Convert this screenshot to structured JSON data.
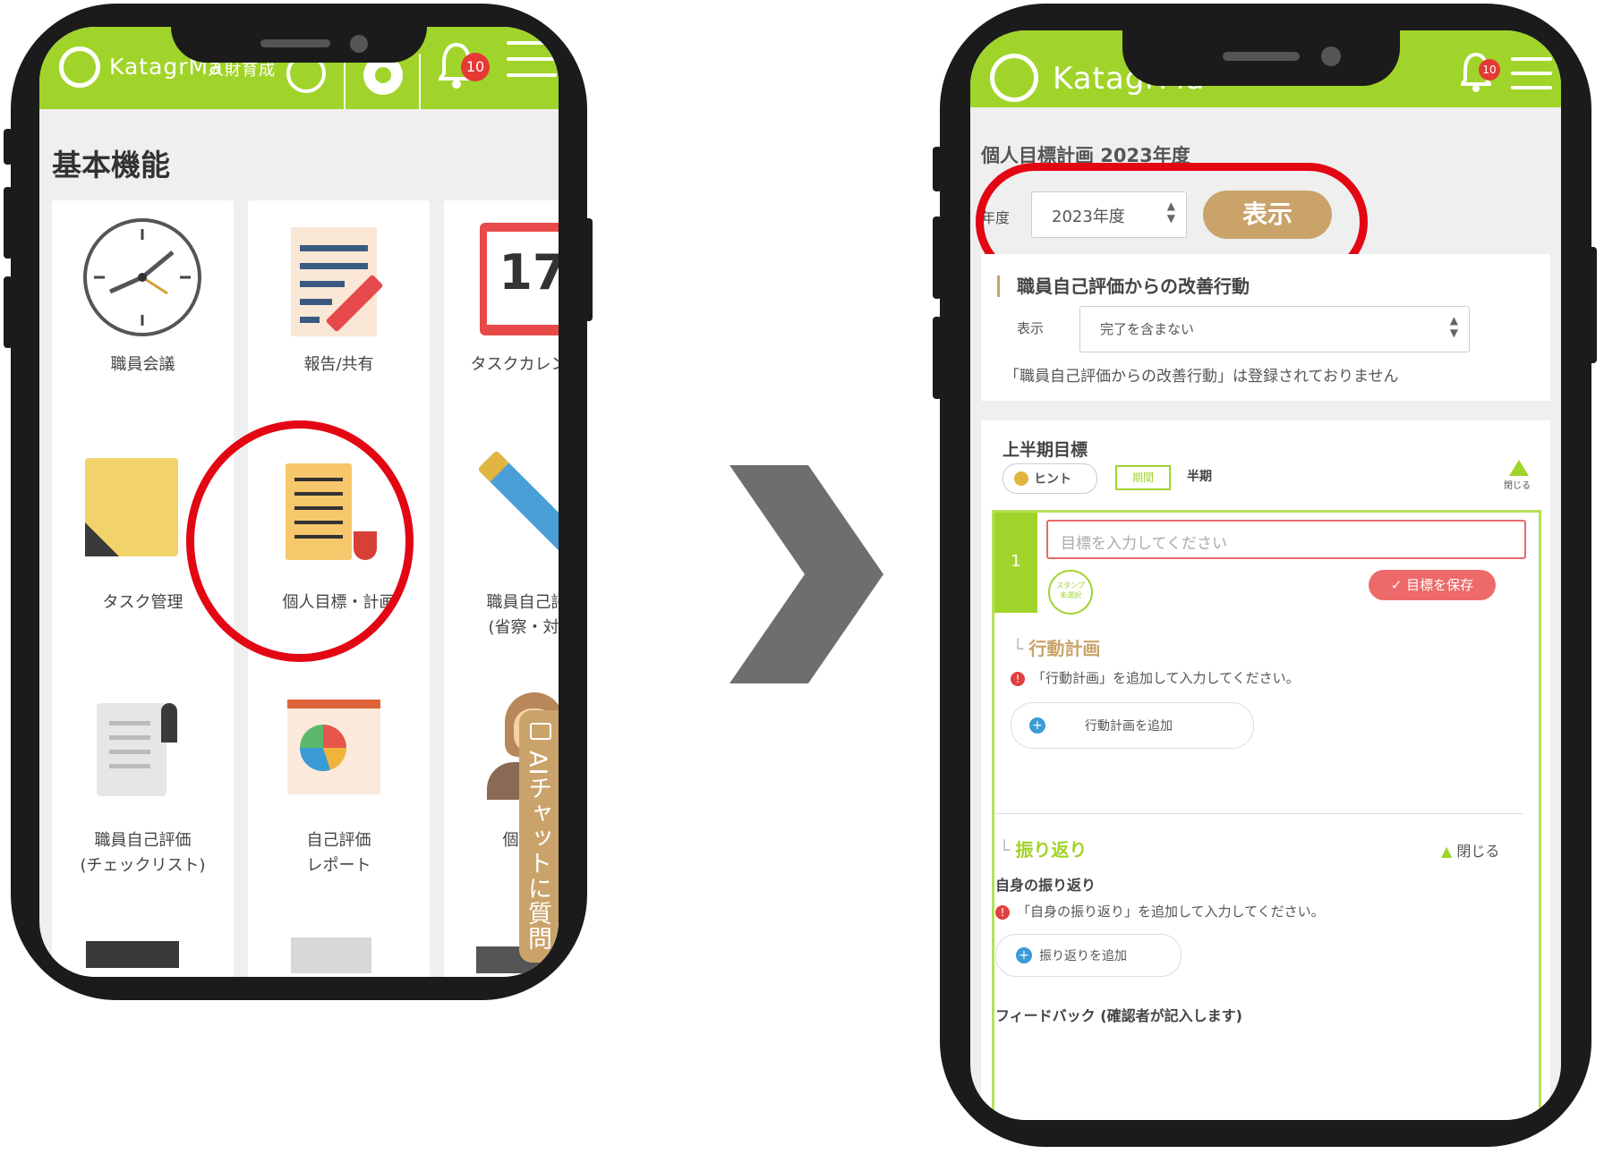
{
  "left_phone": {
    "brand": "KatagrMa",
    "brand_sub": "人財育成",
    "notification_count": "10",
    "section_title": "基本機能",
    "tiles": [
      {
        "label": "職員会議",
        "icon": "clock-icon"
      },
      {
        "label": "報告/共有",
        "icon": "report-icon"
      },
      {
        "label": "タスクカレンダー",
        "icon": "calendar-icon",
        "calendar_day": "17"
      },
      {
        "label": "タスク管理",
        "icon": "sticky-note-icon"
      },
      {
        "label": "個人目標・計画",
        "icon": "scroll-icon"
      },
      {
        "label": "職員自己評価",
        "label2": "(省察・対話)",
        "icon": "pencil-icon"
      },
      {
        "label": "職員自己評価",
        "label2": "(チェックリスト)",
        "icon": "document-icon"
      },
      {
        "label": "自己評価",
        "label2": "レポート",
        "icon": "pie-chart-board-icon"
      },
      {
        "label": "個人面談",
        "icon": "person-icon"
      }
    ],
    "ai_chat_label": "AIチャットに質問"
  },
  "right_phone": {
    "brand": "KatagrMa",
    "notification_count": "10",
    "page_title": "個人目標計画 2023年度",
    "year_label": "年度",
    "year_value": "2023年度",
    "show_button": "表示",
    "improvement_title": "職員自己評価からの改善行動",
    "filter_label": "表示",
    "filter_value": "完了を含まない",
    "improvement_empty": "「職員自己評価からの改善行動」は登録されておりません",
    "half_goal_title": "上半期目標",
    "hint_label": "ヒント",
    "period_label": "期間",
    "period_value": "半期",
    "close_label": "閉じる",
    "goal_number": "1",
    "goal_placeholder": "目標を入力してください",
    "stamp_label": "スタンプ未選択",
    "save_goal_button": "✓ 目標を保存",
    "action_plan_title": "行動計画",
    "action_plan_notice": "「行動計画」を追加して入力してください。",
    "add_action_plan_button": "行動計画を追加",
    "reflection_title": "振り返り",
    "reflection_close": "閉じる",
    "self_reflection_title": "自身の振り返り",
    "self_reflection_notice": "「自身の振り返り」を追加して入力してください。",
    "add_reflection_button": "振り返りを追加",
    "feedback_title": "フィードバック (確認者が記入します)"
  },
  "colors": {
    "brand_green": "#a0d42a",
    "accent_gold": "#c9a36a",
    "highlight_red": "#e30613",
    "badge_red": "#e53935",
    "arrow_gray": "#6e6e6e"
  }
}
